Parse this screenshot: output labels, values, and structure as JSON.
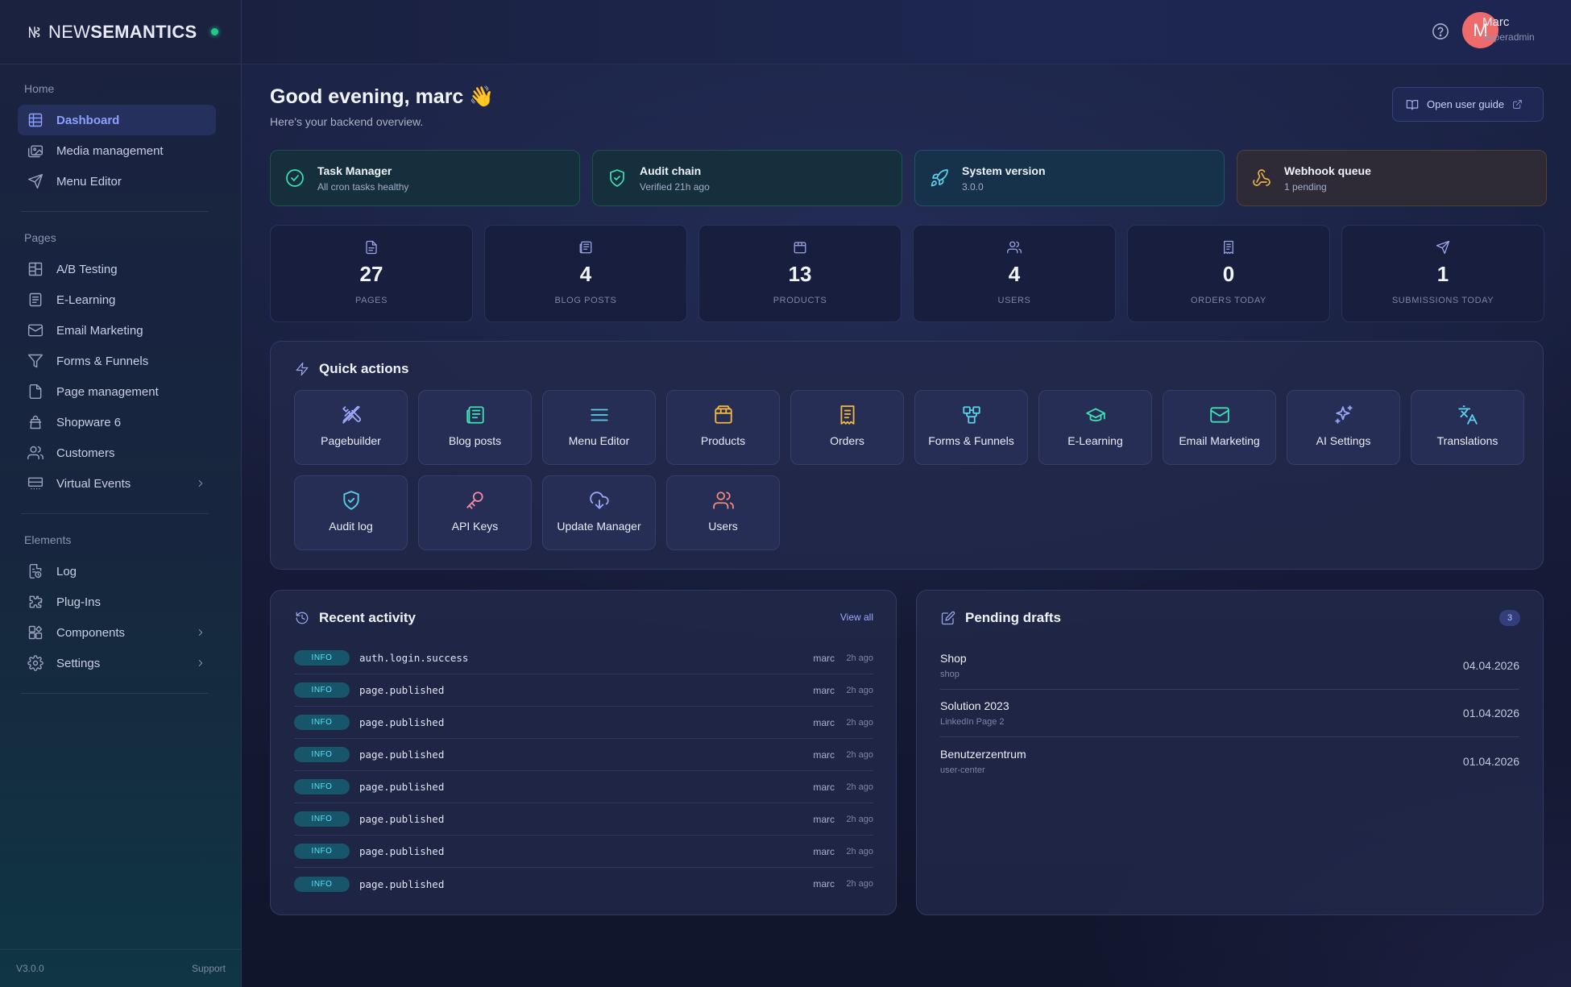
{
  "brand": {
    "light": "NEW",
    "bold": "SEMANTICS"
  },
  "sidebar": {
    "sections": [
      {
        "title": "Home",
        "items": [
          {
            "label": "Dashboard",
            "icon": "grid-icon",
            "active": true
          },
          {
            "label": "Media management",
            "icon": "images-icon"
          },
          {
            "label": "Menu Editor",
            "icon": "send-icon"
          }
        ]
      },
      {
        "title": "Pages",
        "items": [
          {
            "label": "A/B Testing",
            "icon": "split-layout-icon"
          },
          {
            "label": "E-Learning",
            "icon": "book-icon"
          },
          {
            "label": "Email Marketing",
            "icon": "mail-icon"
          },
          {
            "label": "Forms & Funnels",
            "icon": "funnel-icon"
          },
          {
            "label": "Page management",
            "icon": "file-icon"
          },
          {
            "label": "Shopware 6",
            "icon": "shopping-bag-icon"
          },
          {
            "label": "Customers",
            "icon": "users-icon"
          },
          {
            "label": "Virtual Events",
            "icon": "presentation-icon",
            "chevron": true
          }
        ]
      },
      {
        "title": "Elements",
        "items": [
          {
            "label": "Log",
            "icon": "log-icon"
          },
          {
            "label": "Plug-Ins",
            "icon": "puzzle-icon"
          },
          {
            "label": "Components",
            "icon": "components-icon",
            "chevron": true
          },
          {
            "label": "Settings",
            "icon": "gear-icon",
            "chevron": true
          }
        ]
      }
    ],
    "footer": {
      "version": "V3.0.0",
      "support": "Support"
    }
  },
  "topbar": {
    "user_initial": "M",
    "user_name": "Marc",
    "user_role": "Superadmin"
  },
  "main": {
    "greeting": "Good evening, marc 👋",
    "subtitle": "Here's your backend overview.",
    "guide_button": "Open user guide",
    "status_cards": [
      {
        "title": "Task Manager",
        "detail": "All cron tasks healthy",
        "icon": "check-circle-icon",
        "tone": "green"
      },
      {
        "title": "Audit chain",
        "detail": "Verified 21h ago",
        "icon": "shield-check-icon",
        "tone": "green"
      },
      {
        "title": "System version",
        "detail": "3.0.0",
        "icon": "rocket-icon",
        "tone": "teal"
      },
      {
        "title": "Webhook queue",
        "detail": "1 pending",
        "icon": "webhook-icon",
        "tone": "amber"
      }
    ],
    "stats": [
      {
        "value": "27",
        "label": "PAGES",
        "icon": "file-text-icon"
      },
      {
        "value": "4",
        "label": "BLOG POSTS",
        "icon": "newspaper-icon"
      },
      {
        "value": "13",
        "label": "PRODUCTS",
        "icon": "box-icon"
      },
      {
        "value": "4",
        "label": "USERS",
        "icon": "users-icon"
      },
      {
        "value": "0",
        "label": "ORDERS TODAY",
        "icon": "receipt-icon"
      },
      {
        "value": "1",
        "label": "SUBMISSIONS TODAY",
        "icon": "send-icon"
      }
    ],
    "quick_actions": {
      "title": "Quick actions",
      "items": [
        {
          "label": "Pagebuilder",
          "icon": "pencil-ruler-icon",
          "color": "#9aa6f5"
        },
        {
          "label": "Blog posts",
          "icon": "newspaper-icon",
          "color": "#3ee0b1"
        },
        {
          "label": "Menu Editor",
          "icon": "menu-icon",
          "color": "#5ad0e8"
        },
        {
          "label": "Products",
          "icon": "package-icon",
          "color": "#f2b640"
        },
        {
          "label": "Orders",
          "icon": "receipt-icon",
          "color": "#f2b640"
        },
        {
          "label": "Forms & Funnels",
          "icon": "workflow-icon",
          "color": "#5ad0e8"
        },
        {
          "label": "E-Learning",
          "icon": "graduation-cap-icon",
          "color": "#3ee0b1"
        },
        {
          "label": "Email Marketing",
          "icon": "mail-icon",
          "color": "#3ee0b1"
        },
        {
          "label": "AI Settings",
          "icon": "sparkles-icon",
          "color": "#9aa6f5"
        },
        {
          "label": "Translations",
          "icon": "languages-icon",
          "color": "#5ad0e8"
        },
        {
          "label": "Audit log",
          "icon": "shield-check-icon",
          "color": "#5ad0e8"
        },
        {
          "label": "API Keys",
          "icon": "key-icon",
          "color": "#f08aa0"
        },
        {
          "label": "Update Manager",
          "icon": "cloud-download-icon",
          "color": "#9aa6f5"
        },
        {
          "label": "Users",
          "icon": "users-icon",
          "color": "#f08a7a"
        }
      ]
    },
    "recent_activity": {
      "title": "Recent activity",
      "view_all": "View all",
      "rows": [
        {
          "level": "INFO",
          "event": "auth.login.success",
          "user": "marc",
          "time": "2h ago"
        },
        {
          "level": "INFO",
          "event": "page.published",
          "user": "marc",
          "time": "2h ago"
        },
        {
          "level": "INFO",
          "event": "page.published",
          "user": "marc",
          "time": "2h ago"
        },
        {
          "level": "INFO",
          "event": "page.published",
          "user": "marc",
          "time": "2h ago"
        },
        {
          "level": "INFO",
          "event": "page.published",
          "user": "marc",
          "time": "2h ago"
        },
        {
          "level": "INFO",
          "event": "page.published",
          "user": "marc",
          "time": "2h ago"
        },
        {
          "level": "INFO",
          "event": "page.published",
          "user": "marc",
          "time": "2h ago"
        },
        {
          "level": "INFO",
          "event": "page.published",
          "user": "marc",
          "time": "2h ago"
        }
      ]
    },
    "pending_drafts": {
      "title": "Pending drafts",
      "count": "3",
      "rows": [
        {
          "name": "Shop",
          "slug": "shop",
          "date": "04.04.2026"
        },
        {
          "name": "Solution 2023",
          "slug": "LinkedIn Page 2",
          "date": "01.04.2026"
        },
        {
          "name": "Benutzerzentrum",
          "slug": "user-center",
          "date": "01.04.2026"
        }
      ]
    }
  }
}
